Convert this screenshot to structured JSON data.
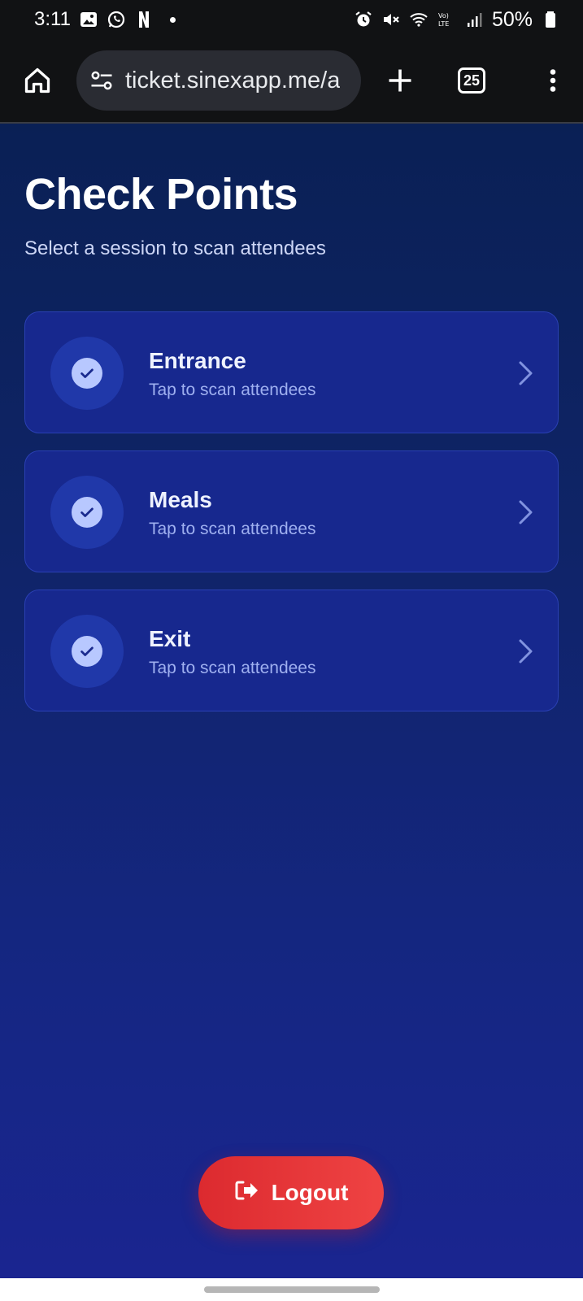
{
  "status_bar": {
    "time": "3:11",
    "battery": "50%",
    "left_icons": [
      "gallery-icon",
      "whatsapp-icon",
      "netflix-icon"
    ],
    "right_icons": [
      "alarm-icon",
      "mute-icon",
      "wifi-icon",
      "volte-icon",
      "signal-icon",
      "battery-icon"
    ]
  },
  "browser": {
    "url": "ticket.sinexapp.me/a",
    "tab_count": "25"
  },
  "page": {
    "title": "Check Points",
    "subtitle": "Select a session to scan attendees"
  },
  "checkpoints": [
    {
      "name": "Entrance",
      "hint": "Tap to scan attendees"
    },
    {
      "name": "Meals",
      "hint": "Tap to scan attendees"
    },
    {
      "name": "Exit",
      "hint": "Tap to scan attendees"
    }
  ],
  "logout": {
    "label": "Logout"
  },
  "colors": {
    "card_bg": "#17288e",
    "accent_red": "#e53737",
    "check_badge": "#b8c8ff"
  }
}
